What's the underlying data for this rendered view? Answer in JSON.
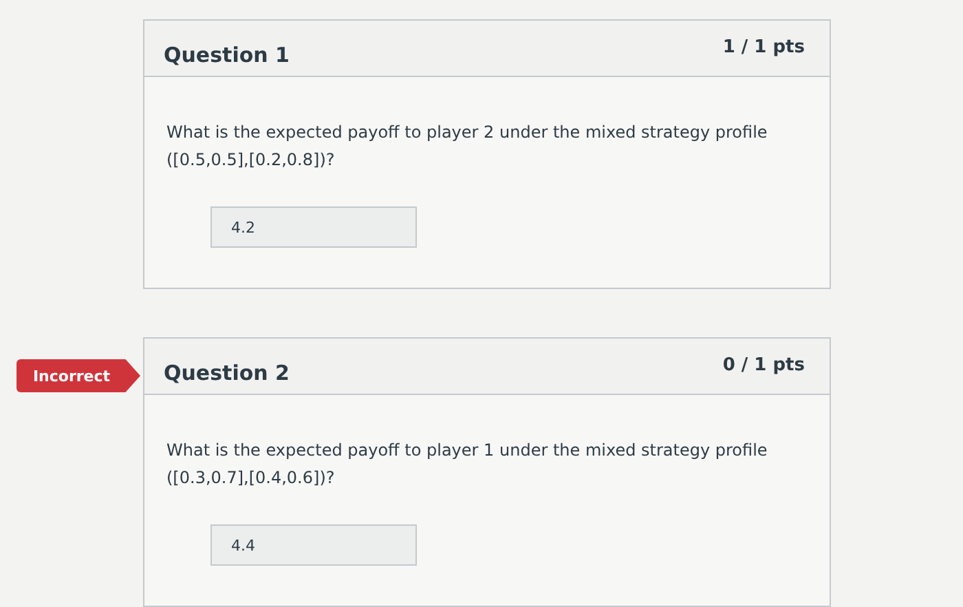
{
  "questions": [
    {
      "title": "Question 1",
      "points": "1 / 1 pts",
      "prompt": "What is the expected payoff to player 2 under the mixed strategy profile ([0.5,0.5],[0.2,0.8])?",
      "answer": "4.2"
    },
    {
      "flag": "Incorrect",
      "title": "Question 2",
      "points": "0 / 1 pts",
      "prompt": "What is the expected payoff to player 1 under the mixed strategy profile ([0.3,0.7],[0.4,0.6])?",
      "answer": "4.4"
    }
  ]
}
